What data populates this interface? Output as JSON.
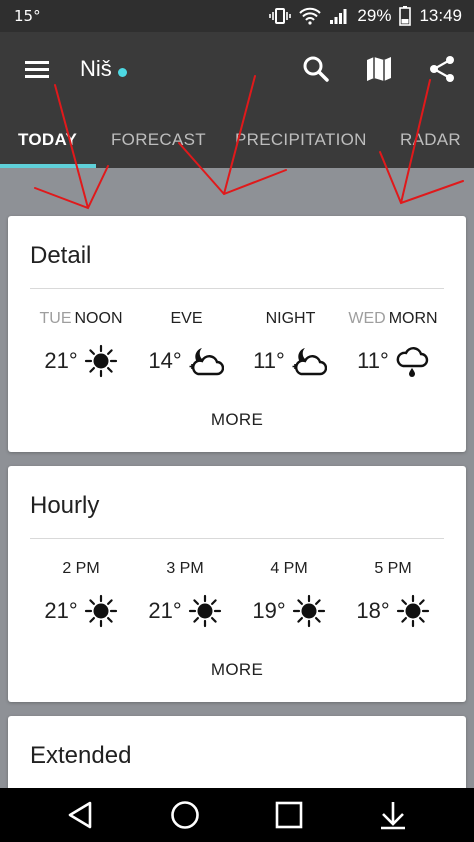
{
  "status_bar": {
    "temperature": "15°",
    "battery": "29%",
    "time": "13:49",
    "icons": [
      "vibrate-icon",
      "wifi-icon",
      "signal-icon",
      "battery-icon"
    ]
  },
  "toolbar": {
    "city": "Niš",
    "icons": [
      "menu-icon",
      "search-icon",
      "map-icon",
      "share-icon"
    ]
  },
  "tabs": [
    {
      "label": "TODAY"
    },
    {
      "label": "FORECAST"
    },
    {
      "label": "PRECIPITATION"
    },
    {
      "label": "RADAR"
    }
  ],
  "detail": {
    "title": "Detail",
    "items": [
      {
        "day": "TUE",
        "period": "NOON",
        "temp": "21°",
        "icon": "sun-icon"
      },
      {
        "day": "",
        "period": "EVE",
        "temp": "14°",
        "icon": "partly-cloudy-night-icon"
      },
      {
        "day": "",
        "period": "NIGHT",
        "temp": "11°",
        "icon": "partly-cloudy-night-icon"
      },
      {
        "day": "WED",
        "period": "MORN",
        "temp": "11°",
        "icon": "rain-cloud-icon"
      }
    ],
    "more": "MORE"
  },
  "hourly": {
    "title": "Hourly",
    "items": [
      {
        "time": "2 PM",
        "temp": "21°",
        "icon": "sun-icon"
      },
      {
        "time": "3 PM",
        "temp": "21°",
        "icon": "sun-icon"
      },
      {
        "time": "4 PM",
        "temp": "19°",
        "icon": "sun-icon"
      },
      {
        "time": "5 PM",
        "temp": "18°",
        "icon": "sun-icon"
      }
    ],
    "more": "MORE"
  },
  "extended": {
    "title": "Extended"
  },
  "nav": {
    "icons": [
      "back-icon",
      "home-icon",
      "recents-icon",
      "download-icon"
    ]
  },
  "colors": {
    "app_bar": "#3a3a3a",
    "status_bar": "#2f2f2f",
    "accent": "#5fd0d9",
    "annotation": "#e0191b"
  }
}
